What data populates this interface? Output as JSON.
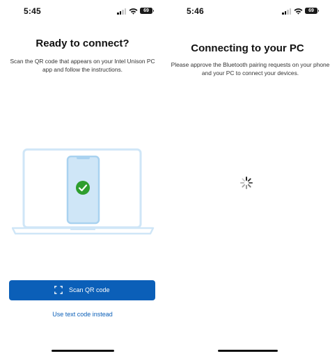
{
  "left_screen": {
    "status_bar": {
      "time": "5:45",
      "battery_level": "69",
      "icons": [
        "signal-icon",
        "wifi-icon",
        "battery-icon"
      ]
    },
    "title": "Ready to connect?",
    "subtitle": "Scan the QR code that appears on your Intel Unison PC app and follow the instructions.",
    "illustration_icons": [
      "laptop-icon",
      "phone-icon",
      "checkmark-icon"
    ],
    "primary_button": {
      "label": "Scan QR code",
      "icon": "qr-scan-icon",
      "color": "#0b5fb8"
    },
    "secondary_link": "Use text code instead"
  },
  "right_screen": {
    "status_bar": {
      "time": "5:46",
      "battery_level": "69",
      "icons": [
        "signal-icon",
        "wifi-icon",
        "battery-icon"
      ]
    },
    "title": "Connecting to your PC",
    "subtitle": "Please approve the Bluetooth pairing requests on your phone and your PC to connect your devices.",
    "loading_icon": "spinner-icon"
  },
  "colors": {
    "accent": "#0b5fb8",
    "success": "#2e9e2e",
    "illustration_light": "#cfe6f7",
    "illustration_line": "#a9d2f0"
  }
}
